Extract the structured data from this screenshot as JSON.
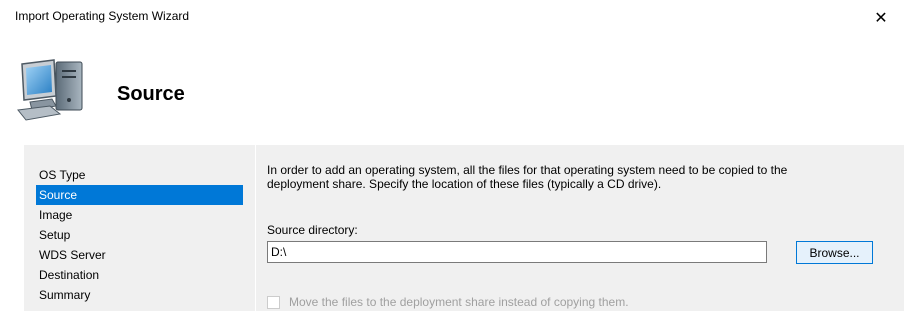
{
  "window": {
    "title": "Import Operating System Wizard",
    "close_glyph": "✕"
  },
  "header": {
    "icon": "computer-icon",
    "page_title": "Source"
  },
  "sidebar": {
    "items": [
      {
        "label": "OS Type",
        "selected": false
      },
      {
        "label": "Source",
        "selected": true
      },
      {
        "label": "Image",
        "selected": false
      },
      {
        "label": "Setup",
        "selected": false
      },
      {
        "label": "WDS Server",
        "selected": false
      },
      {
        "label": "Destination",
        "selected": false
      },
      {
        "label": "Summary",
        "selected": false
      }
    ]
  },
  "main": {
    "intro_line1": "In order to add an operating system, all the files for that operating system need to be copied to the",
    "intro_line2": "deployment share.  Specify the location of these files (typically a CD drive).",
    "source_label": "Source directory:",
    "source_value": "D:\\",
    "browse_label": "Browse...",
    "move_label": "Move the files to the deployment share instead of copying them.",
    "move_checked": false,
    "move_enabled": false
  },
  "colors": {
    "selection": "#0078d7",
    "panel_bg": "#f0f0f0",
    "disabled_text": "#a0a0a0"
  }
}
